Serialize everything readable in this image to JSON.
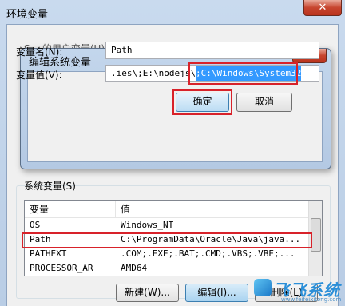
{
  "outer_window": {
    "title": "环境变量",
    "close_glyph": "✕",
    "user_vars_label_partial": "S...    的用户变量(U)"
  },
  "edit_dialog": {
    "title": "编辑系统变量",
    "close_glyph": "✕",
    "name_label": "变量名(N):",
    "value_label": "变量值(V):",
    "name_value": "Path",
    "value_text_prefix": ".ies\\;E:\\nodejs\\",
    "value_text_selected": ";C:\\Windows\\System32",
    "ok_label": "确定",
    "cancel_label": "取消"
  },
  "system_vars": {
    "label": "系统变量(S)",
    "columns": [
      "变量",
      "值"
    ],
    "rows": [
      {
        "name": "OS",
        "value": "Windows_NT"
      },
      {
        "name": "Path",
        "value": "C:\\ProgramData\\Oracle\\Java\\java..."
      },
      {
        "name": "PATHEXT",
        "value": ".COM;.EXE;.BAT;.CMD;.VBS;.VBE;..."
      },
      {
        "name": "PROCESSOR_AR",
        "value": "AMD64"
      }
    ],
    "buttons": {
      "new": "新建(W)...",
      "edit": "编辑(I)...",
      "delete": "删除(L)"
    }
  },
  "watermark": {
    "text": "飞飞系统",
    "url": "www.feifeixitong.com"
  },
  "colors": {
    "highlight_red": "#d8222a",
    "selection_blue": "#3399ff",
    "title_gradient": "#c9daee"
  }
}
